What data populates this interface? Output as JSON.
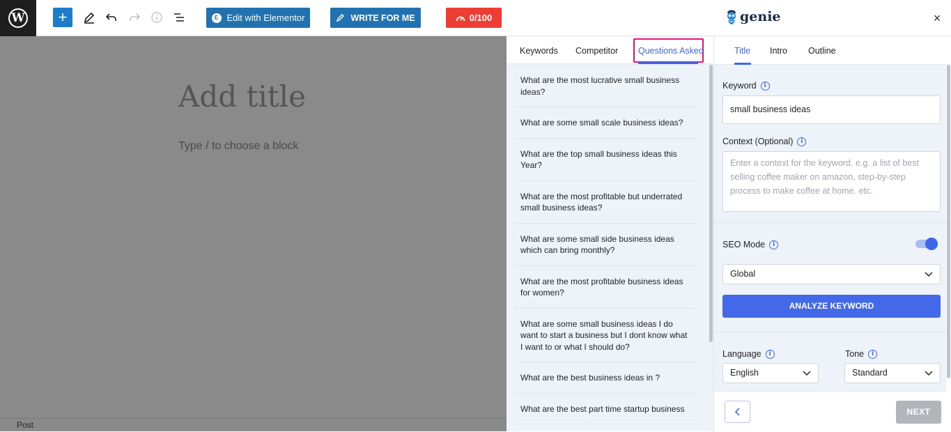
{
  "toolbar": {
    "wp_logo": "W",
    "add_label": "+",
    "elementor_label": "Edit with Elementor",
    "elementor_badge": "E",
    "write_label": "WRITE FOR ME",
    "score_label": "0/100"
  },
  "editor": {
    "title_placeholder": "Add title",
    "block_placeholder": "Type / to choose a block",
    "status": "Post"
  },
  "questions_panel": {
    "tabs": [
      "Keywords",
      "Competitor",
      "Questions Asked"
    ],
    "active_tab": "Questions Asked",
    "questions": [
      "What are the most lucrative small business ideas?",
      "What are some small scale business ideas?",
      "What are the top small business ideas this Year?",
      "What are the most profitable but underrated small business ideas?",
      "What are some small side business ideas which can bring monthly?",
      "What are the most profitable business ideas for women?",
      "What are some small business ideas I do want to start a business but I dont know what I want to or what I should do?",
      "What are the best business ideas in ?",
      "What are the best part time startup business"
    ]
  },
  "genie": {
    "brand": "genie",
    "close": "×",
    "tabs": [
      "Title",
      "Intro",
      "Outline"
    ],
    "active_tab": "Title",
    "keyword_label": "Keyword",
    "keyword_value": "small business ideas",
    "context_label": "Context (Optional)",
    "context_placeholder": "Enter a context for the keyword. e.g. a list of best selling coffee maker on amazon, step-by-step process to make coffee at home. etc.",
    "seo_mode_label": "SEO Mode",
    "seo_mode_on": true,
    "seo_mode_value": "Global",
    "analyze_label": "ANALYZE KEYWORD",
    "language_label": "Language",
    "language_value": "English",
    "tone_label": "Tone",
    "tone_value": "Standard",
    "next_label": "NEXT",
    "info_glyph": "i"
  },
  "colors": {
    "accent": "#3f66e6",
    "wp_blue": "#2271b1",
    "score_red": "#ee3d34",
    "highlight": "#e5127d"
  }
}
